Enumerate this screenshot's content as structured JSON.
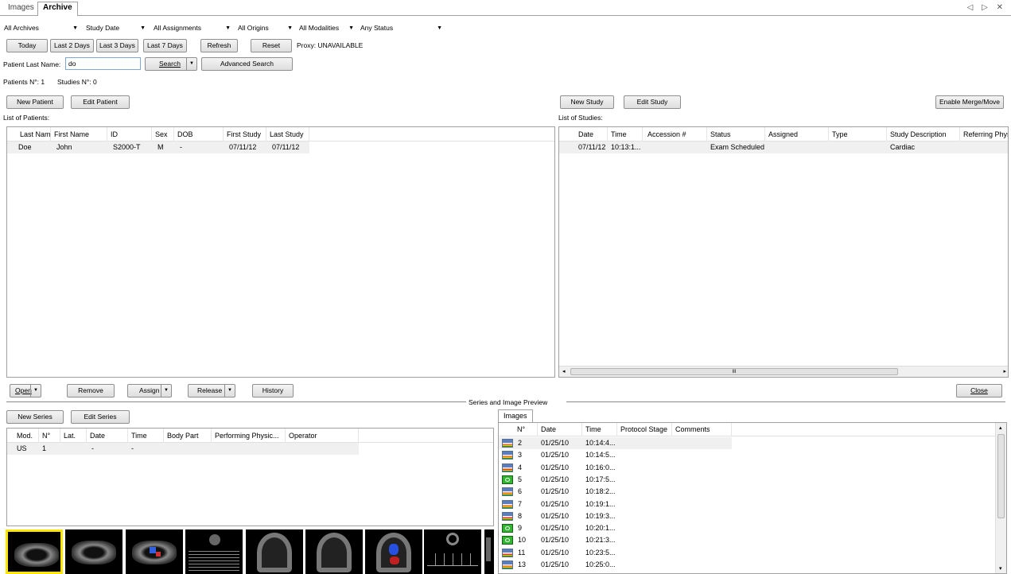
{
  "tabs": [
    "Images",
    "Archive"
  ],
  "active_tab": "Archive",
  "window_controls": "◁ ▷ ✕",
  "filters": {
    "archive": "All Archives",
    "date_field": "Study Date",
    "assignments": "All Assignments",
    "origins": "All Origins",
    "modalities": "All Modalities",
    "status": "Any Status"
  },
  "date_buttons": {
    "today": "Today",
    "last2": "Last 2 Days",
    "last3": "Last 3 Days",
    "last7": "Last 7 Days",
    "refresh": "Refresh",
    "reset": "Reset"
  },
  "proxy": "Proxy: UNAVAILABLE",
  "search": {
    "label": "Patient Last Name:",
    "value": "do",
    "search_btn": "Search",
    "advanced_btn": "Advanced Search"
  },
  "counts": {
    "patients": "Patients N°: 1",
    "studies": "Studies N°: 0"
  },
  "patients": {
    "new_btn": "New Patient",
    "edit_btn": "Edit Patient",
    "list_label": "List of Patients:",
    "columns": [
      "Last Name",
      "First Name",
      "ID",
      "Sex",
      "DOB",
      "First Study",
      "Last Study"
    ],
    "rows": [
      [
        "Doe",
        "John",
        "S2000-T",
        "M",
        "-",
        "07/11/12",
        "07/11/12"
      ]
    ]
  },
  "studies": {
    "new_btn": "New Study",
    "edit_btn": "Edit Study",
    "merge_btn": "Enable Merge/Move",
    "list_label": "List of Studies:",
    "columns": [
      "Date",
      "Time",
      "Accession #",
      "Status",
      "Assigned",
      "Type",
      "Study Description",
      "Referring Phys"
    ],
    "rows": [
      [
        "07/11/12",
        "10:13:1...",
        "",
        "Exam Scheduled",
        "",
        "",
        "Cardiac",
        ""
      ]
    ],
    "scroll_grip": "III"
  },
  "actions": {
    "open": "Open",
    "remove": "Remove",
    "assign": "Assign",
    "release": "Release",
    "history": "History",
    "close": "Close"
  },
  "section_title": "Series and Image Preview",
  "series": {
    "new_btn": "New Series",
    "edit_btn": "Edit Series",
    "columns": [
      "Mod.",
      "N°",
      "Lat.",
      "Date",
      "Time",
      "Body Part",
      "Performing Physic...",
      "Operator"
    ],
    "rows": [
      [
        "US",
        "1",
        "",
        "-",
        "-",
        "",
        "",
        ""
      ]
    ]
  },
  "images": {
    "tab": "Images",
    "columns": [
      "N°",
      "Date",
      "Time",
      "Protocol Stage",
      "Comments"
    ],
    "rows": [
      {
        "n": "2",
        "date": "01/25/10",
        "time": "10:14:4...",
        "icon": "cine-icon"
      },
      {
        "n": "3",
        "date": "01/25/10",
        "time": "10:14:5...",
        "icon": "cine-icon"
      },
      {
        "n": "4",
        "date": "01/25/10",
        "time": "10:16:0...",
        "icon": "cine-icon"
      },
      {
        "n": "5",
        "date": "01/25/10",
        "time": "10:17:5...",
        "icon": "still-icon"
      },
      {
        "n": "6",
        "date": "01/25/10",
        "time": "10:18:2...",
        "icon": "cine-icon"
      },
      {
        "n": "7",
        "date": "01/25/10",
        "time": "10:19:1...",
        "icon": "cine-icon"
      },
      {
        "n": "8",
        "date": "01/25/10",
        "time": "10:19:3...",
        "icon": "cine-icon"
      },
      {
        "n": "9",
        "date": "01/25/10",
        "time": "10:20:1...",
        "icon": "still-icon"
      },
      {
        "n": "10",
        "date": "01/25/10",
        "time": "10:21:3...",
        "icon": "still-icon"
      },
      {
        "n": "11",
        "date": "01/25/10",
        "time": "10:23:5...",
        "icon": "cine-icon"
      },
      {
        "n": "13",
        "date": "01/25/10",
        "time": "10:25:0...",
        "icon": "cine-icon"
      }
    ]
  },
  "thumbnails": [
    "echo-plax",
    "echo-plax",
    "echo-color-doppler",
    "echo-mmode",
    "echo-apical",
    "echo-apical-4ch",
    "echo-color-apical",
    "echo-doppler-trace",
    "echo-partial"
  ],
  "colors": {
    "accent_yellow": "#ffe600",
    "input_border": "#7fa7d0",
    "still_green": "#2fb82f"
  }
}
